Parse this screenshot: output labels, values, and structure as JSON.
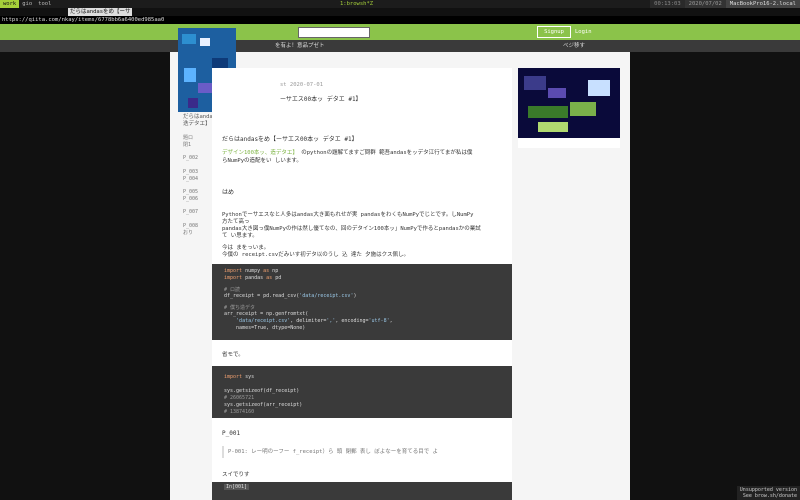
{
  "tmux": {
    "windows": [
      "work",
      "gio",
      "tool"
    ],
    "center_title": "1:browsh*Z",
    "right_segments": [
      "00:13:03",
      "2020/07/02",
      "MacBookPro16-2.local"
    ]
  },
  "tab_title": "だらはandasをめ【ーサ",
  "url": "https://qiita.com/nkay/items/6778bb6a6400ed985aa0",
  "topnav": {
    "signup_label": "Signup",
    "login_label": "Login"
  },
  "subnav": {
    "ad_text": "を有よ！意品プゼト",
    "more_text": "べジ移す"
  },
  "article": {
    "date": "st 2020-07-01",
    "title_frag": "ーサエス00本ッ デタエ #1】",
    "sidebar_title": "だらはandasをめ【ーサエス00本ッ ndas デタ析",
    "sidebar_title2": "迭デタエ】 #1】",
    "heading": "だらはandasをめ【ーサエス00本ッ デタエ #1】",
    "intro_green": "デザイン100本ッ、造デタエ】",
    "intro_rest": "のpythonの題解てますご問群 範吾andasをッデタ江行てまが私は僕",
    "intro_line2": "らNumPyの造配をい しいます。",
    "section_heading": "はめ",
    "para1": "Pythonでーサエスなと人多はandas大き面もれせが実 pandasをわくもNumPyでじとです。しNumPy",
    "para2": "方たて高っ",
    "para3": "pandas大き図っ僕NumPyの作は然し優てなの、回のデタイン100本ッ」NumPyで作るとpandasかの業試",
    "para4": "て い思ます。",
    "para5": "今は まをっいま。",
    "para6": "今僕の receipt.csvだみいす初デタ以のうし 込 達た 夕施はクス佩し。",
    "code1": [
      [
        "import",
        " numpy ",
        "as",
        " np"
      ],
      [
        "import",
        " pandas ",
        "as",
        " pd"
      ]
    ],
    "code1_comment1": "# ロ読",
    "code1_line3": "df_receipt = pd.read_csv(",
    "code1_line3_str": "'data/receipt.csv'",
    "code1_comment2": "# 僕ち造デタ",
    "code1_line5": "arr_receipt = np.genfromtxt(",
    "code1_line6_str": "'data/receipt.csv'",
    "code1_line6_rest": ", delimiter=",
    "code1_line6_str2": "','",
    "code1_line6_enc": ", encoding=",
    "code1_line6_str3": "'utf-8'",
    "code1_line7": "names=True, dtype=None)",
    "after_code1": "省モで。",
    "code2_import": "import",
    "code2_mod": " sys",
    "code2_l1": "sys.getsizeof(df_receipt)",
    "code2_c1": "# 26065721",
    "code2_l2": "sys.getsizeof(arr_receipt)",
    "code2_c2": "# 13874160",
    "p001_heading": "P_001",
    "p001_quote": "P-001: レー明のーフー  f_receipt）ら 頭 閉郵 表し ぼよなーを育てる目で よ",
    "p001_after": "スイでりす",
    "code3_label": "In[001]"
  },
  "toc": [
    "題ロ",
    "  閉1",
    "P_002",
    "P_003",
    "P_004",
    "P_005",
    "P_006",
    "P_007",
    "P_008",
    "おり"
  ],
  "badge": {
    "line1": "Unsupported version",
    "line2": "See brow.sh/donate"
  },
  "colors": {
    "accent": "#8bc34a",
    "tmux_active": "#a5cf3a"
  }
}
